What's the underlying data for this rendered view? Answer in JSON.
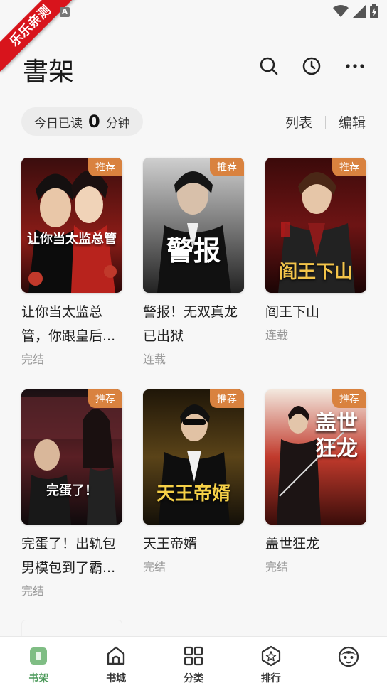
{
  "status_bar": {
    "ribbon": "乐乐亲测",
    "badge": "A"
  },
  "header": {
    "title": "書架"
  },
  "reading": {
    "prefix": "今日已读",
    "minutes": "0",
    "unit": "分钟"
  },
  "view": {
    "list_label": "列表",
    "edit_label": "编辑"
  },
  "badge_label": "推荐",
  "books": [
    {
      "title": "让你当太监总管，你跟皇后...",
      "status": "完结",
      "cover_text": "让你当太监总管"
    },
    {
      "title": "警报！无双真龙已出狱",
      "status": "连载",
      "cover_text": "警报"
    },
    {
      "title": "阎王下山",
      "status": "连载",
      "cover_text": "阎王下山"
    },
    {
      "title": "完蛋了！出轨包男模包到了霸...",
      "status": "完结",
      "cover_text": "完蛋了！"
    },
    {
      "title": "天王帝婿",
      "status": "完结",
      "cover_text": "天王帝婿"
    },
    {
      "title": "盖世狂龙",
      "status": "完结",
      "cover_text": "盖世狂龙"
    }
  ],
  "nav": [
    {
      "label": "书架",
      "icon": "bookshelf-icon",
      "active": true
    },
    {
      "label": "书城",
      "icon": "bookstore-icon"
    },
    {
      "label": "分类",
      "icon": "category-icon"
    },
    {
      "label": "排行",
      "icon": "ranking-icon"
    },
    {
      "label": "",
      "icon": "profile-icon"
    }
  ],
  "colors": {
    "accent": "#4c9a5a",
    "badge": "#d9823f",
    "ribbon": "#d8141c"
  }
}
